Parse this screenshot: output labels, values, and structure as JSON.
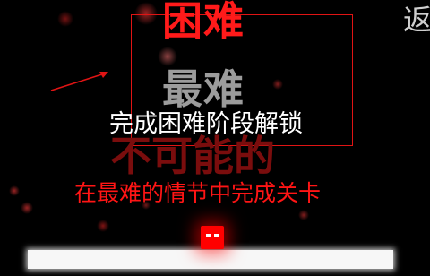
{
  "level": {
    "title_hard": "困难",
    "title_hardest": "最难",
    "title_impossible": "不可能的",
    "unlock_message": "完成困难阶段解锁",
    "description": "在最难的情节中完成关卡"
  },
  "nav": {
    "back_label": "返"
  },
  "colors": {
    "background": "#000000",
    "accent_red": "#ff1a1a",
    "dark_red": "#7a0d0d",
    "grey": "#9c9c9c",
    "floor": "#f7f7f7"
  },
  "icons": {
    "pointer": "arrow-icon",
    "player": "player-icon"
  }
}
